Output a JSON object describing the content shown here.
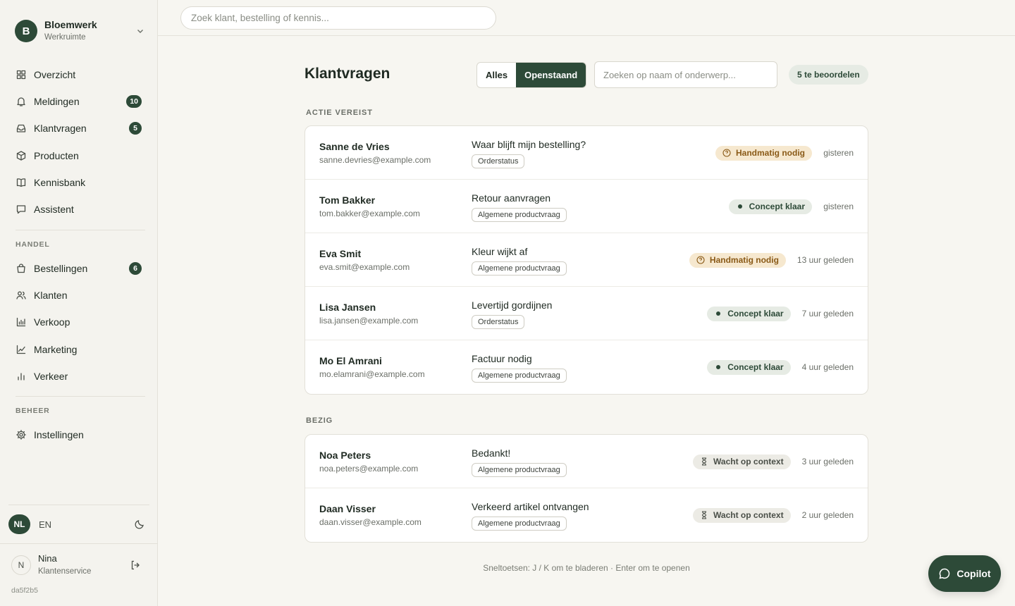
{
  "workspace": {
    "initial": "B",
    "name": "Bloemwerk",
    "sub": "Werkruimte"
  },
  "nav_main": [
    {
      "label": "Overzicht",
      "icon": "grid-icon"
    },
    {
      "label": "Meldingen",
      "icon": "bell-icon",
      "count": "10"
    },
    {
      "label": "Klantvragen",
      "icon": "inbox-icon",
      "count": "5"
    },
    {
      "label": "Producten",
      "icon": "box-icon"
    },
    {
      "label": "Kennisbank",
      "icon": "book-icon"
    },
    {
      "label": "Assistent",
      "icon": "chat-icon"
    }
  ],
  "section_handel": "HANDEL",
  "nav_handel": [
    {
      "label": "Bestellingen",
      "icon": "bag-icon",
      "count": "6"
    },
    {
      "label": "Klanten",
      "icon": "users-icon"
    },
    {
      "label": "Verkoop",
      "icon": "bar-chart-icon"
    },
    {
      "label": "Marketing",
      "icon": "line-chart-icon"
    },
    {
      "label": "Verkeer",
      "icon": "stats-icon"
    }
  ],
  "section_beheer": "BEHEER",
  "nav_beheer": [
    {
      "label": "Instellingen",
      "icon": "gear-icon"
    }
  ],
  "lang": {
    "active": "NL",
    "other": "EN"
  },
  "user": {
    "initial": "N",
    "name": "Nina",
    "role": "Klantenservice"
  },
  "build_hash": "da5f2b5",
  "topbar": {
    "search_placeholder": "Zoek klant, bestelling of kennis..."
  },
  "main": {
    "title": "Klantvragen",
    "filters": [
      "Alles",
      "Openstaand"
    ],
    "active_filter": "Openstaand",
    "search_placeholder": "Zoeken op naam of onderwerp...",
    "review_count": "5 te beoordelen"
  },
  "groups": [
    {
      "label": "ACTIE VEREIST",
      "rows": [
        {
          "name": "Sanne de Vries",
          "email": "sanne.devries@example.com",
          "subject": "Waar blijft mijn bestelling?",
          "tag": "Orderstatus",
          "status": "Handmatig nodig",
          "status_type": "manual",
          "time": "gisteren"
        },
        {
          "name": "Tom Bakker",
          "email": "tom.bakker@example.com",
          "subject": "Retour aanvragen",
          "tag": "Algemene productvraag",
          "status": "Concept klaar",
          "status_type": "concept",
          "time": "gisteren"
        },
        {
          "name": "Eva Smit",
          "email": "eva.smit@example.com",
          "subject": "Kleur wijkt af",
          "tag": "Algemene productvraag",
          "status": "Handmatig nodig",
          "status_type": "manual",
          "time": "13 uur geleden"
        },
        {
          "name": "Lisa Jansen",
          "email": "lisa.jansen@example.com",
          "subject": "Levertijd gordijnen",
          "tag": "Orderstatus",
          "status": "Concept klaar",
          "status_type": "concept",
          "time": "7 uur geleden"
        },
        {
          "name": "Mo El Amrani",
          "email": "mo.elamrani@example.com",
          "subject": "Factuur nodig",
          "tag": "Algemene productvraag",
          "status": "Concept klaar",
          "status_type": "concept",
          "time": "4 uur geleden"
        }
      ]
    },
    {
      "label": "BEZIG",
      "rows": [
        {
          "name": "Noa Peters",
          "email": "noa.peters@example.com",
          "subject": "Bedankt!",
          "tag": "Algemene productvraag",
          "status": "Wacht op context",
          "status_type": "wait",
          "time": "3 uur geleden"
        },
        {
          "name": "Daan Visser",
          "email": "daan.visser@example.com",
          "subject": "Verkeerd artikel ontvangen",
          "tag": "Algemene productvraag",
          "status": "Wacht op context",
          "status_type": "wait",
          "time": "2 uur geleden"
        }
      ]
    }
  ],
  "shortcut_hint": "Sneltoetsen: J / K om te bladeren · Enter om te openen",
  "copilot_label": "Copilot",
  "colors": {
    "accent": "#2d4a38",
    "manual_bg": "#f6e8cf",
    "manual_fg": "#8a5a17",
    "concept_bg": "#e6ebe4",
    "wait_bg": "#ecebe5"
  }
}
